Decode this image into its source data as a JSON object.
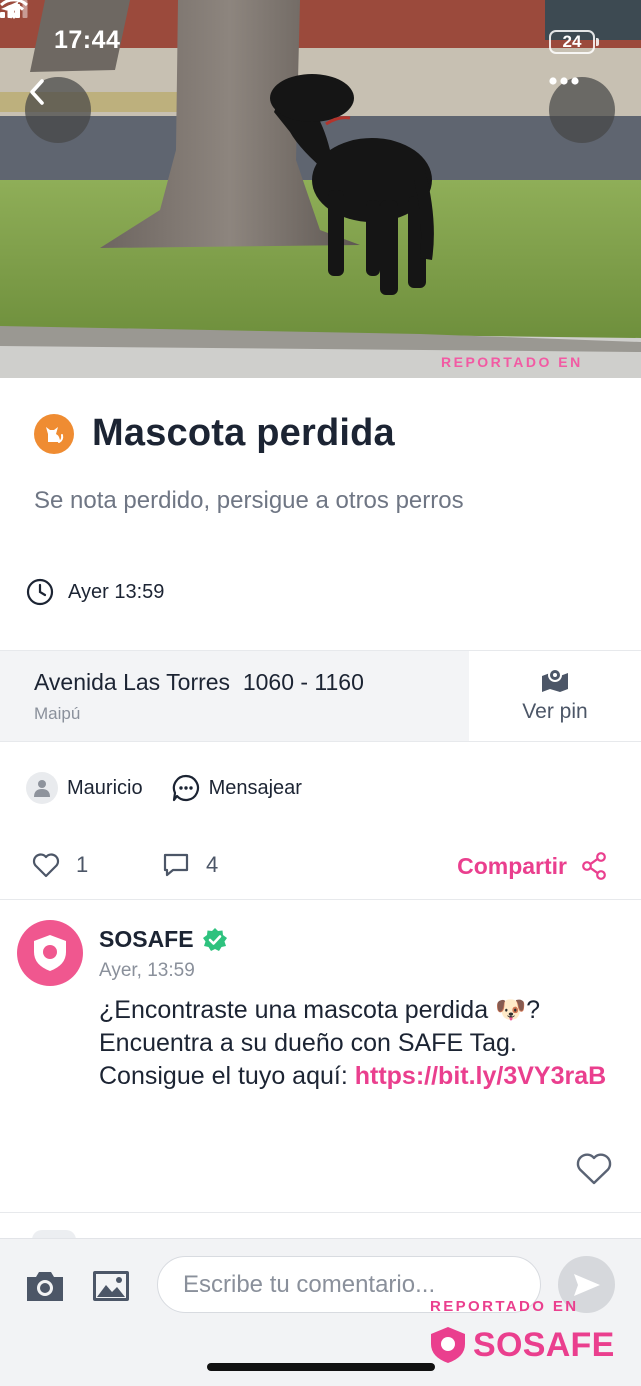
{
  "status_bar": {
    "time": "17:44",
    "battery": "24"
  },
  "photo": {
    "watermark": "REPORTADO EN"
  },
  "incident": {
    "title": "Mascota perdida",
    "description": "Se nota perdido, persigue a otros perros",
    "time": "Ayer 13:59",
    "address": {
      "street": "Avenida Las Torres  1060 - 1160",
      "commune": "Maipú"
    },
    "ver_pin_label": "Ver pin",
    "author": "Mauricio",
    "message_label": "Mensajear",
    "likes": "1",
    "comments": "4",
    "share_label": "Compartir"
  },
  "comment": {
    "author": "SOSAFE",
    "time": "Ayer, 13:59",
    "text_before_link": "¿Encontraste una mascota perdida 🐶? Encuentra a su dueño con SAFE Tag. Consigue el tuyo aquí: ",
    "link": "https://bit.ly/3VY3raB"
  },
  "composer": {
    "placeholder": "Escribe tu comentario..."
  },
  "watermark": {
    "reportado": "REPORTADO EN",
    "brand": "SOSAFE"
  },
  "colors": {
    "accent": "#ea3f8e",
    "category": "#ef8c32",
    "verified": "#2ec27e"
  }
}
